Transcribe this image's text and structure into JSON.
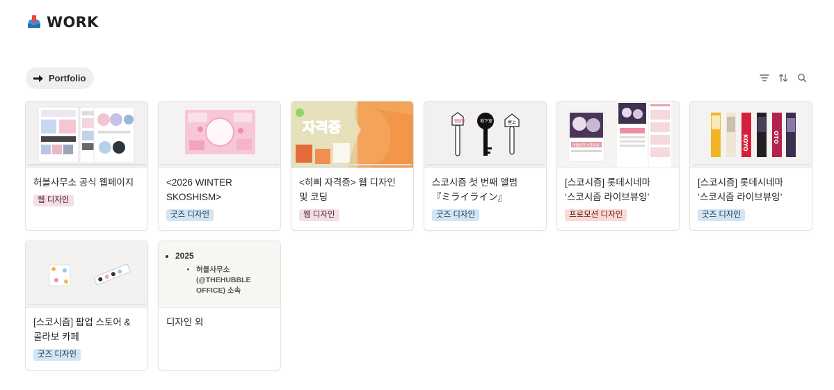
{
  "page": {
    "title": "WORK",
    "icon": "inbox-tray-icon"
  },
  "view": {
    "tab_label": "Portfolio",
    "tab_icon": "right-arrow-icon"
  },
  "toolbar": {
    "filter_icon": "filter-icon",
    "sort_icon": "sort-icon",
    "search_icon": "search-icon"
  },
  "cards": [
    {
      "title": "허블사무소 공식 웹페이지",
      "tag": "웹 디자인",
      "tag_type": "web"
    },
    {
      "title": "<2026 WINTER SKOSHISM>",
      "tag": "굿즈 디자인",
      "tag_type": "goods"
    },
    {
      "title": "<히삐 자격증> 웹 디자인 및 코딩",
      "tag": "웹 디자인",
      "tag_type": "web"
    },
    {
      "title": "스코시즘 첫 번째 앨범『ミライライン』",
      "tag": "굿즈 디자인",
      "tag_type": "goods"
    },
    {
      "title": "[스코시즘] 롯데시네마 ‘스코시즘 라이브뷰잉’",
      "tag": "프로모션 디자인",
      "tag_type": "promo"
    },
    {
      "title": "[스코시즘] 롯데시네마 ‘스코시즘 라이브뷰잉’",
      "tag": "굿즈 디자인",
      "tag_type": "goods"
    },
    {
      "title": "[스코시즘] 팝업 스토어 & 콜라보 카페",
      "tag": "굿즈 디자인",
      "tag_type": "goods"
    },
    {
      "title": "디자인 외",
      "tag": "",
      "tag_type": ""
    }
  ],
  "doc_preview": {
    "year": "2025",
    "entry": "허블사무소 (@THEHUBBLE OFFICE) 소속"
  },
  "thumb_text": {
    "hibi_title": "자격증",
    "key_tag_1": "웹웹웹",
    "key_tag_2": "地下室",
    "key_tag_3": "屋上",
    "cinema_label": "여름방학 보충수업",
    "slogan_1": "KOYO",
    "slogan_2": "OTO"
  },
  "colors": {
    "tag_web_bg": "#f5dde6",
    "tag_goods_bg": "#d3e5f5",
    "tag_promo_bg": "#fbd9d5",
    "tab_bg": "#efefed"
  }
}
